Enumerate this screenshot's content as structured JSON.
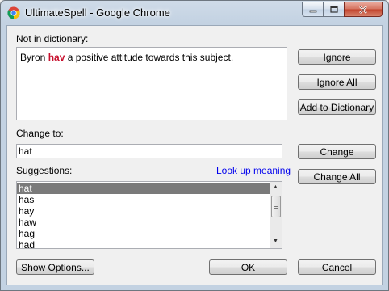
{
  "window": {
    "title": "UltimateSpell - Google Chrome"
  },
  "dialog": {
    "not_in_dictionary_label": "Not in dictionary:",
    "sentence": {
      "before": "Byron ",
      "word": "hav",
      "after": " a positive attitude towards this subject."
    },
    "change_to_label": "Change to:",
    "change_to_value": "hat",
    "suggestions_label": "Suggestions:",
    "look_up_link": "Look up meaning",
    "suggestions": [
      "hat",
      "has",
      "hay",
      "haw",
      "hag",
      "had"
    ],
    "selected_suggestion": "hat"
  },
  "buttons": {
    "ignore": "Ignore",
    "ignore_all": "Ignore All",
    "add_to_dictionary": "Add to Dictionary",
    "change": "Change",
    "change_all": "Change All",
    "show_options": "Show Options...",
    "ok": "OK",
    "cancel": "Cancel"
  },
  "colors": {
    "misspelled_word": "#c8102e",
    "selection": "#7a7a7a",
    "link": "#0000ee"
  }
}
